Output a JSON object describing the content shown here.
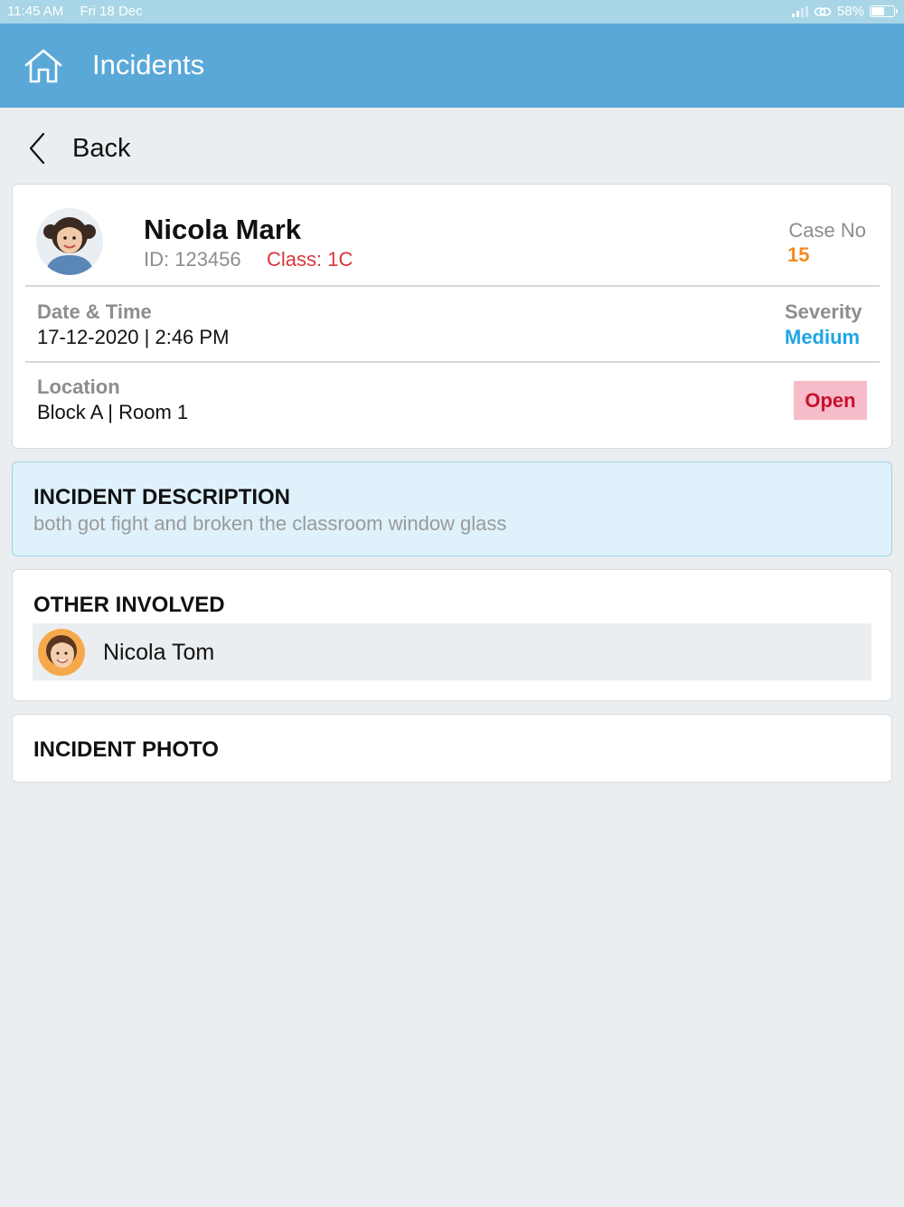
{
  "status_bar": {
    "time": "11:45 AM",
    "date": "Fri 18 Dec",
    "battery": "58%",
    "battery_level": 0.58
  },
  "header": {
    "title": "Incidents",
    "icon": "home-icon"
  },
  "nav": {
    "back_label": "Back",
    "icon": "chevron-left-icon"
  },
  "student": {
    "name": "Nicola Mark",
    "id": "ID: 123456",
    "class": "Class: 1C",
    "case_label": "Case No",
    "case_value": "15"
  },
  "details": {
    "datetime_label": "Date & Time",
    "datetime_value": "17-12-2020 | 2:46 PM",
    "severity_label": "Severity",
    "severity_value": "Medium",
    "location_label": "Location",
    "location_value": "Block A | Room 1",
    "status": "Open"
  },
  "description": {
    "title": "INCIDENT DESCRIPTION",
    "text": "both got fight and broken the classroom window glass"
  },
  "involved": {
    "title": "OTHER INVOLVED",
    "people": [
      {
        "name": "Nicola Tom"
      }
    ]
  },
  "photo": {
    "title": "INCIDENT PHOTO"
  },
  "colors": {
    "header": "#5aa8d8",
    "status_bar": "#a8d6e6",
    "case_number": "#f28b24",
    "severity": "#1ea6e4",
    "class_text": "#d9363e",
    "status_badge_bg": "#f7bcc9",
    "status_badge_text": "#c8102e",
    "description_bg": "#dff2fb"
  }
}
